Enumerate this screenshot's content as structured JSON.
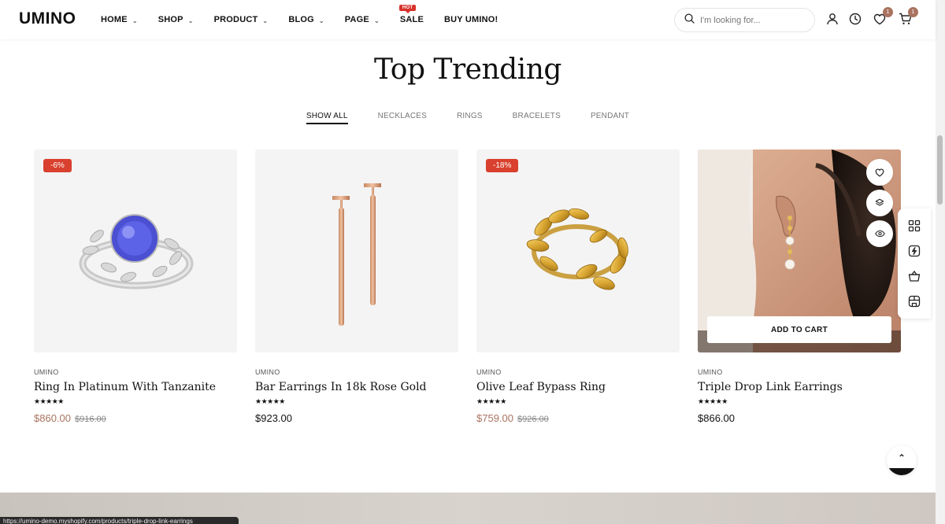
{
  "header": {
    "logo": "UMINO",
    "nav": [
      {
        "label": "HOME",
        "dropdown": true
      },
      {
        "label": "SHOP",
        "dropdown": true
      },
      {
        "label": "PRODUCT",
        "dropdown": true
      },
      {
        "label": "BLOG",
        "dropdown": true
      },
      {
        "label": "PAGE",
        "dropdown": true
      },
      {
        "label": "SALE",
        "dropdown": false,
        "badge": "HOT"
      },
      {
        "label": "BUY UMINO!",
        "dropdown": false
      }
    ],
    "search_placeholder": "I'm looking for...",
    "wishlist_count": "1",
    "cart_count": "1"
  },
  "section": {
    "title": "Top Trending",
    "tabs": [
      "SHOW ALL",
      "NECKLACES",
      "RINGS",
      "BRACELETS",
      "PENDANT"
    ],
    "active_tab": "SHOW ALL"
  },
  "products": [
    {
      "brand": "UMINO",
      "name": "Ring In Platinum With Tanzanite",
      "price": "$860.00",
      "compare_price": "$916.00",
      "badge": "-6%",
      "rating": 5,
      "on_sale": true
    },
    {
      "brand": "UMINO",
      "name": "Bar Earrings In 18k Rose Gold",
      "price": "$923.00",
      "compare_price": "",
      "badge": "",
      "rating": 5,
      "on_sale": false
    },
    {
      "brand": "UMINO",
      "name": "Olive Leaf Bypass Ring",
      "price": "$759.00",
      "compare_price": "$926.00",
      "badge": "-18%",
      "rating": 5,
      "on_sale": true
    },
    {
      "brand": "UMINO",
      "name": "Triple Drop Link Earrings",
      "price": "$866.00",
      "compare_price": "",
      "badge": "",
      "rating": 5,
      "on_sale": false,
      "add_to_cart": "ADD TO CART"
    }
  ],
  "stars": "★★★★★",
  "status_url": "https://umino-demo.myshopify.com/products/triple-drop-link-earrings",
  "colors": {
    "accent": "#a9735f",
    "badge_red": "#d9402d",
    "hot_red": "#d7312b"
  },
  "icons": [
    "search-icon",
    "user-icon",
    "clock-icon",
    "heart-icon",
    "cart-icon",
    "compare-icon",
    "eye-icon",
    "grid-icon",
    "lightning-icon",
    "basket-icon",
    "store-icon",
    "chevron-up-icon"
  ]
}
